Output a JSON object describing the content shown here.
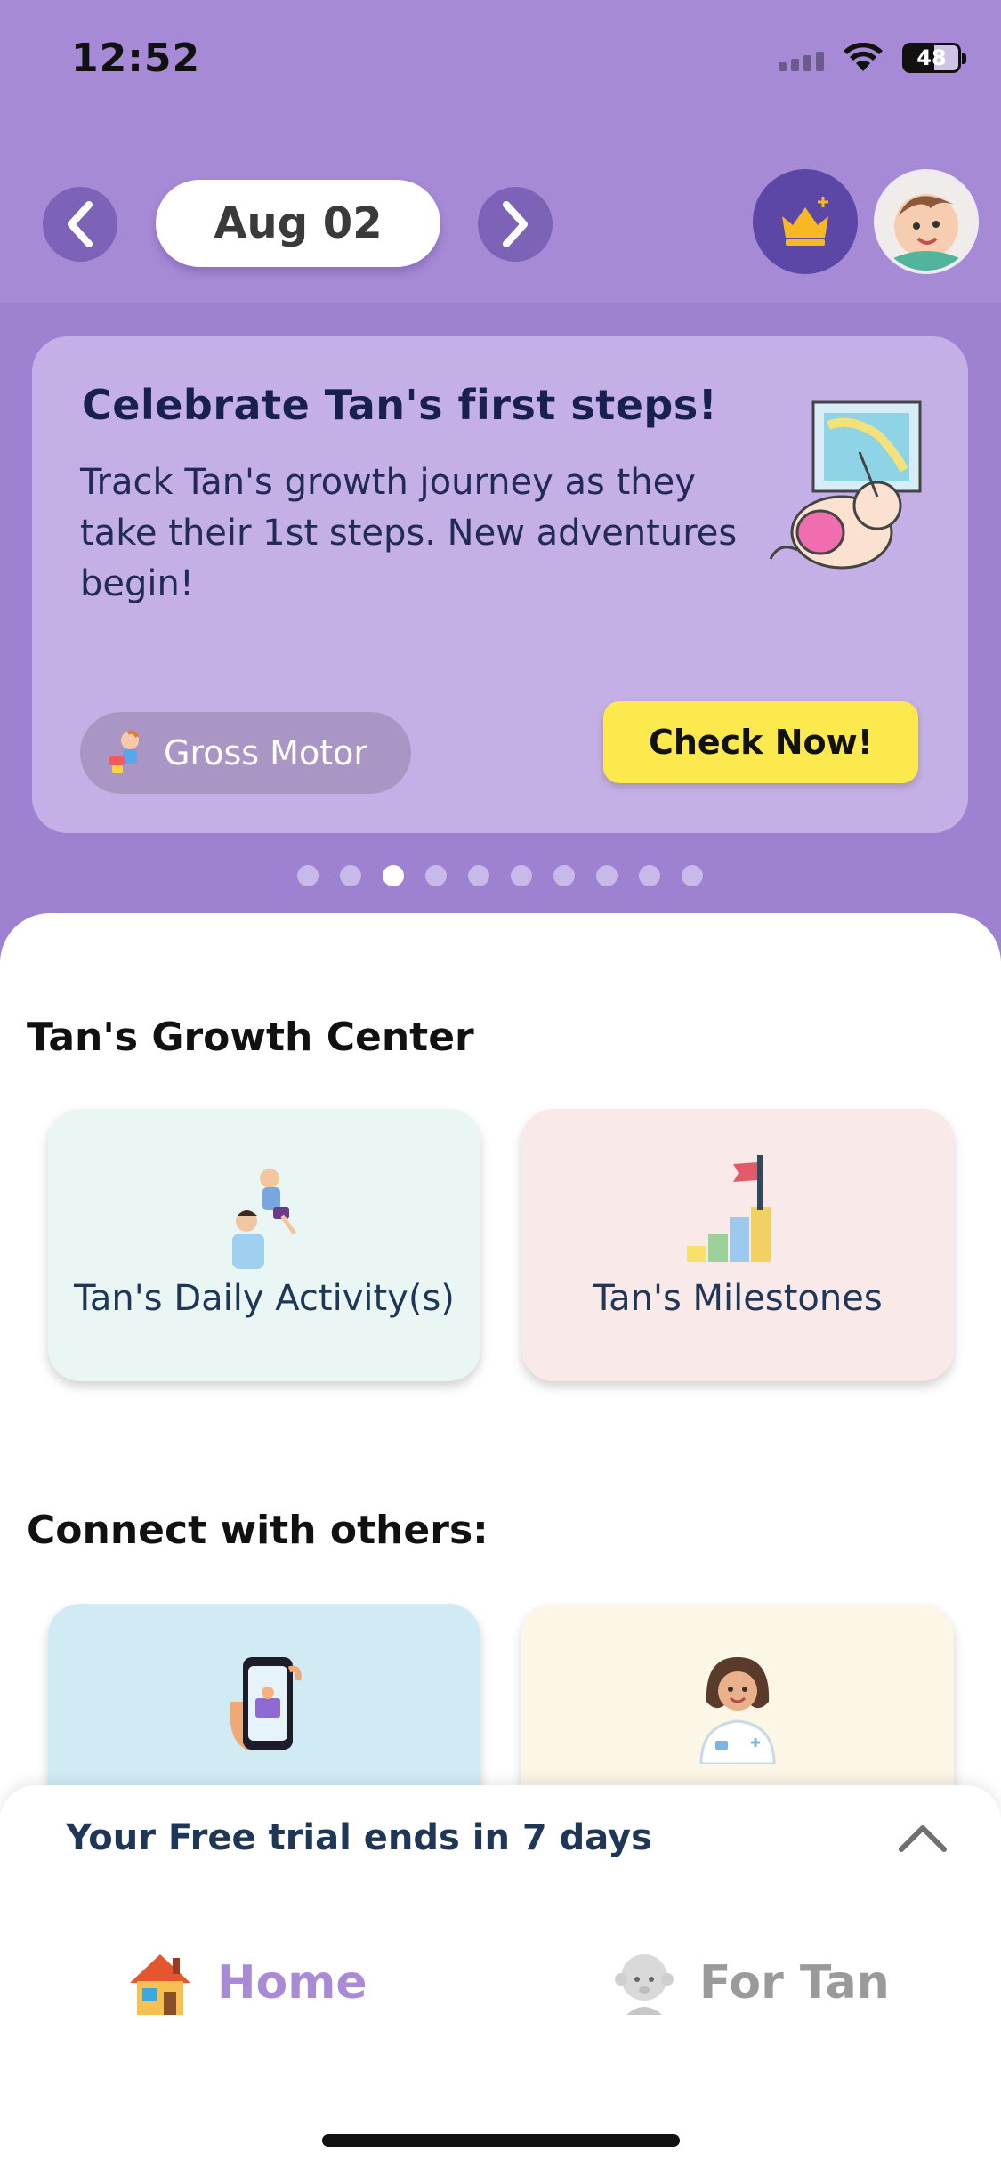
{
  "status_bar": {
    "time": "12:52",
    "battery": "48"
  },
  "header": {
    "date": "Aug 02"
  },
  "hero": {
    "title": "Celebrate Tan's first steps!",
    "description": "Track Tan's growth journey as they take their 1st steps. New adventures begin!",
    "chip_label": "Gross Motor",
    "cta_label": "Check Now!",
    "carousel": {
      "count": 10,
      "active_index": 2
    }
  },
  "growth_center": {
    "title": "Tan's Growth Center",
    "tiles": [
      {
        "label": "Tan's Daily Activity(s)",
        "color": "#eaf6f3"
      },
      {
        "label": "Tan's Milestones",
        "color": "#f9e9e8"
      }
    ]
  },
  "connect": {
    "title": "Connect with others:"
  },
  "trial_banner": {
    "text": "Your Free trial ends in 7 days"
  },
  "tabbar": {
    "items": [
      {
        "label": "Home",
        "icon": "house-icon",
        "active": true
      },
      {
        "label": "For Tan",
        "icon": "baby-icon",
        "active": false
      }
    ]
  },
  "colors": {
    "brand": "#a78ad6",
    "accent": "#fbe94e",
    "active_tab": "#a88ad6",
    "inactive_tab": "#9a9a9a"
  }
}
